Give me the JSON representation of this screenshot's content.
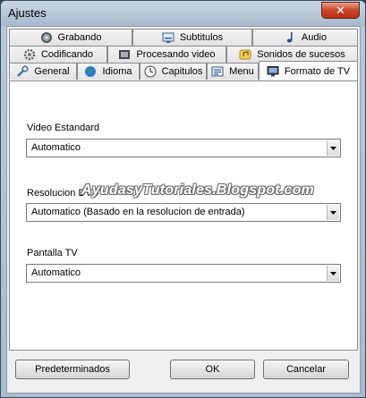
{
  "window": {
    "title": "Ajustes",
    "close_glyph": "✕"
  },
  "tabs_row1": [
    {
      "label": "Grabando",
      "icon": "cd-burn-icon"
    },
    {
      "label": "Subtitulos",
      "icon": "subtitles-icon"
    },
    {
      "label": "Audio",
      "icon": "music-note-icon"
    }
  ],
  "tabs_row2": [
    {
      "label": "Codificando",
      "icon": "gear-icon"
    },
    {
      "label": "Procesando video",
      "icon": "film-icon"
    },
    {
      "label": "Sonidos de sucesos",
      "icon": "sounds-icon"
    }
  ],
  "tabs_row3": [
    {
      "label": "General",
      "icon": "wrench-icon"
    },
    {
      "label": "Idioma",
      "icon": "globe-icon"
    },
    {
      "label": "Capitulos",
      "icon": "clock-icon"
    },
    {
      "label": "Menu",
      "icon": "menu-icon"
    },
    {
      "label": "Formato de TV",
      "icon": "monitor-icon",
      "active": true
    }
  ],
  "fields": {
    "video_standard": {
      "label": "Video Estandard",
      "value": "Automatico"
    },
    "dvd_resolution": {
      "label": "Resolucion DVD",
      "value": "Automatico (Basado en la resolucion de entrada)"
    },
    "tv_screen": {
      "label": "Pantalla TV",
      "value": "Automatico"
    }
  },
  "watermark": "AyudasyTutoriales.Blogspot.com",
  "buttons": {
    "defaults": "Predeterminados",
    "ok": "OK",
    "cancel": "Cancelar"
  }
}
